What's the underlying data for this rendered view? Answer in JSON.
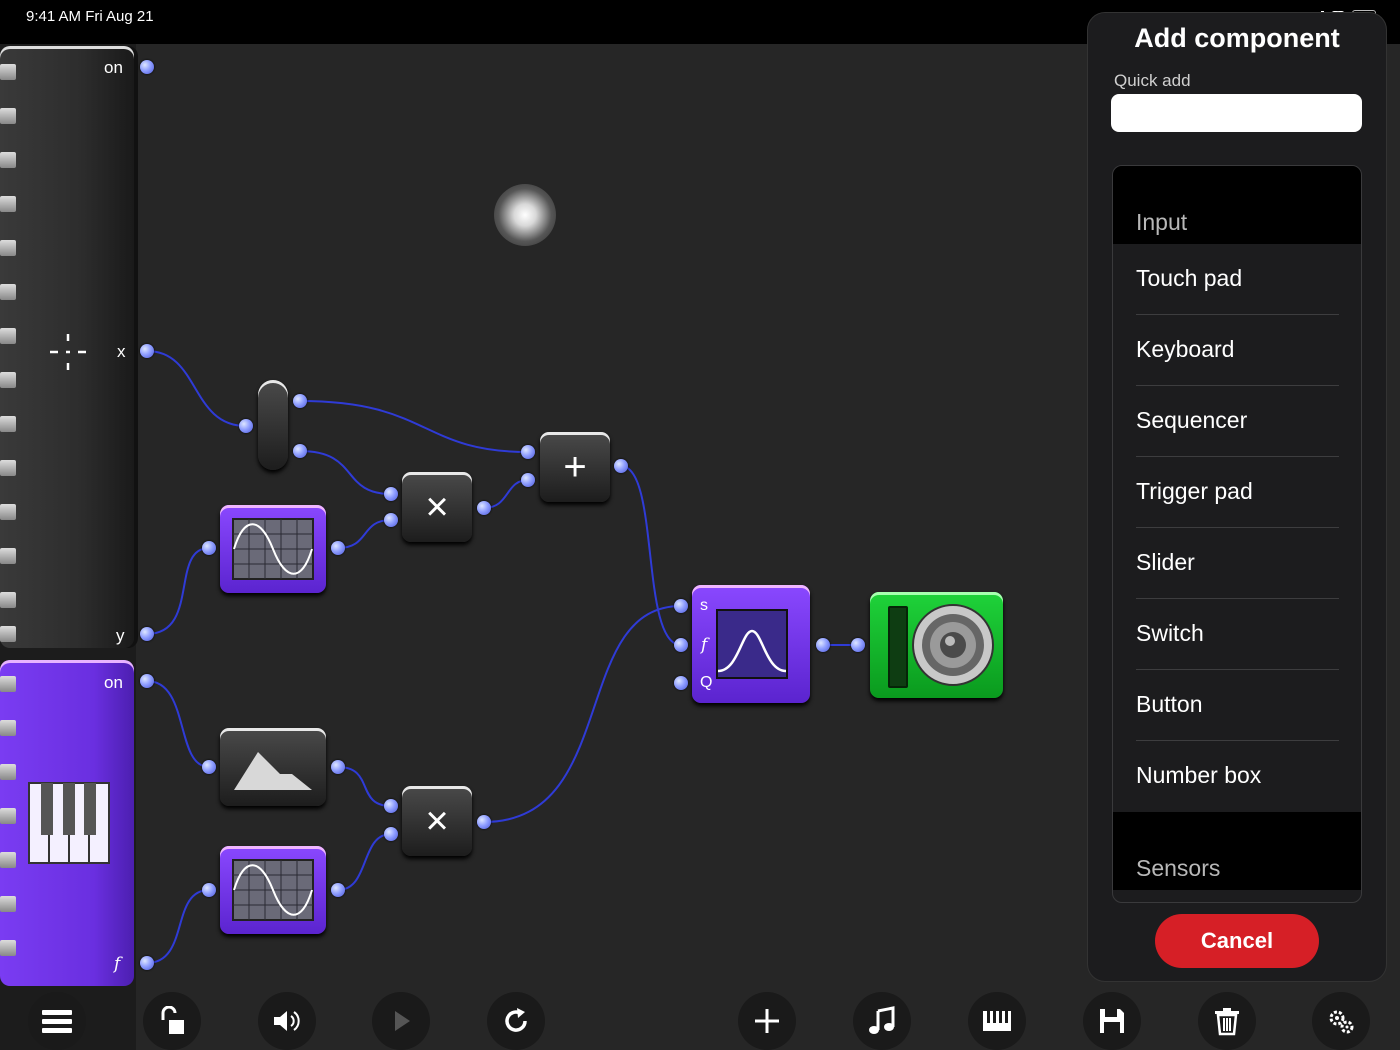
{
  "status_bar": {
    "time": "9:41 AM  Fri Aug 21"
  },
  "touchpad": {
    "on_label": "on",
    "x_label": "x",
    "y_label": "y"
  },
  "keyboard_component": {
    "on_label": "on",
    "f_label": "f"
  },
  "operators": {
    "add": "+",
    "multiply": "×"
  },
  "filter": {
    "s_label": "s",
    "f_label": "f",
    "q_label": "Q"
  },
  "add_component_panel": {
    "title": "Add component",
    "quick_add_label": "Quick add",
    "quick_add_value": "",
    "sections": [
      {
        "label": "Input",
        "items": [
          "Touch pad",
          "Keyboard",
          "Sequencer",
          "Trigger pad",
          "Slider",
          "Switch",
          "Button",
          "Number box"
        ]
      },
      {
        "label": "Sensors",
        "items": []
      }
    ],
    "cancel_label": "Cancel"
  },
  "toolbar": {
    "buttons": [
      "menu-icon",
      "lock-icon",
      "speaker-icon",
      "play-icon",
      "refresh-icon",
      "add-icon",
      "music-note-icon",
      "piano-icon",
      "save-icon",
      "trash-icon",
      "settings-icon"
    ]
  },
  "colors": {
    "wire": "#2f3bd6",
    "cancel": "#d61f26",
    "purple": "#7a3cf2",
    "green": "#12b82a"
  }
}
